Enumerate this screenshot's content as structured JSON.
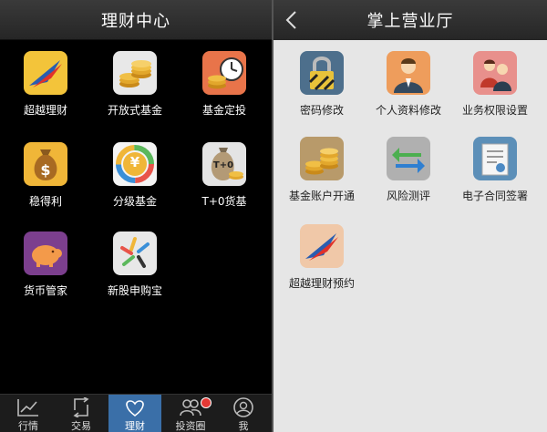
{
  "left": {
    "title": "理财中心",
    "items": [
      {
        "label": "超越理财"
      },
      {
        "label": "开放式基金"
      },
      {
        "label": "基金定投"
      },
      {
        "label": "稳得利"
      },
      {
        "label": "分级基金"
      },
      {
        "label": "T+0货基"
      },
      {
        "label": "货币管家"
      },
      {
        "label": "新股申购宝"
      }
    ],
    "t0_icon_text": "T+0",
    "fenji_icon_text": "¥",
    "tabs": [
      {
        "label": "行情"
      },
      {
        "label": "交易"
      },
      {
        "label": "理财"
      },
      {
        "label": "投资圈"
      },
      {
        "label": "我"
      }
    ]
  },
  "right": {
    "title": "掌上营业厅",
    "items": [
      {
        "label": "密码修改"
      },
      {
        "label": "个人资料修改"
      },
      {
        "label": "业务权限设置"
      },
      {
        "label": "基金账户开通"
      },
      {
        "label": "风险测评"
      },
      {
        "label": "电子合同签署"
      },
      {
        "label": "超越理财预约"
      }
    ]
  },
  "colors": {
    "active_tab": "#3a6fa8",
    "badge": "#e53935"
  }
}
